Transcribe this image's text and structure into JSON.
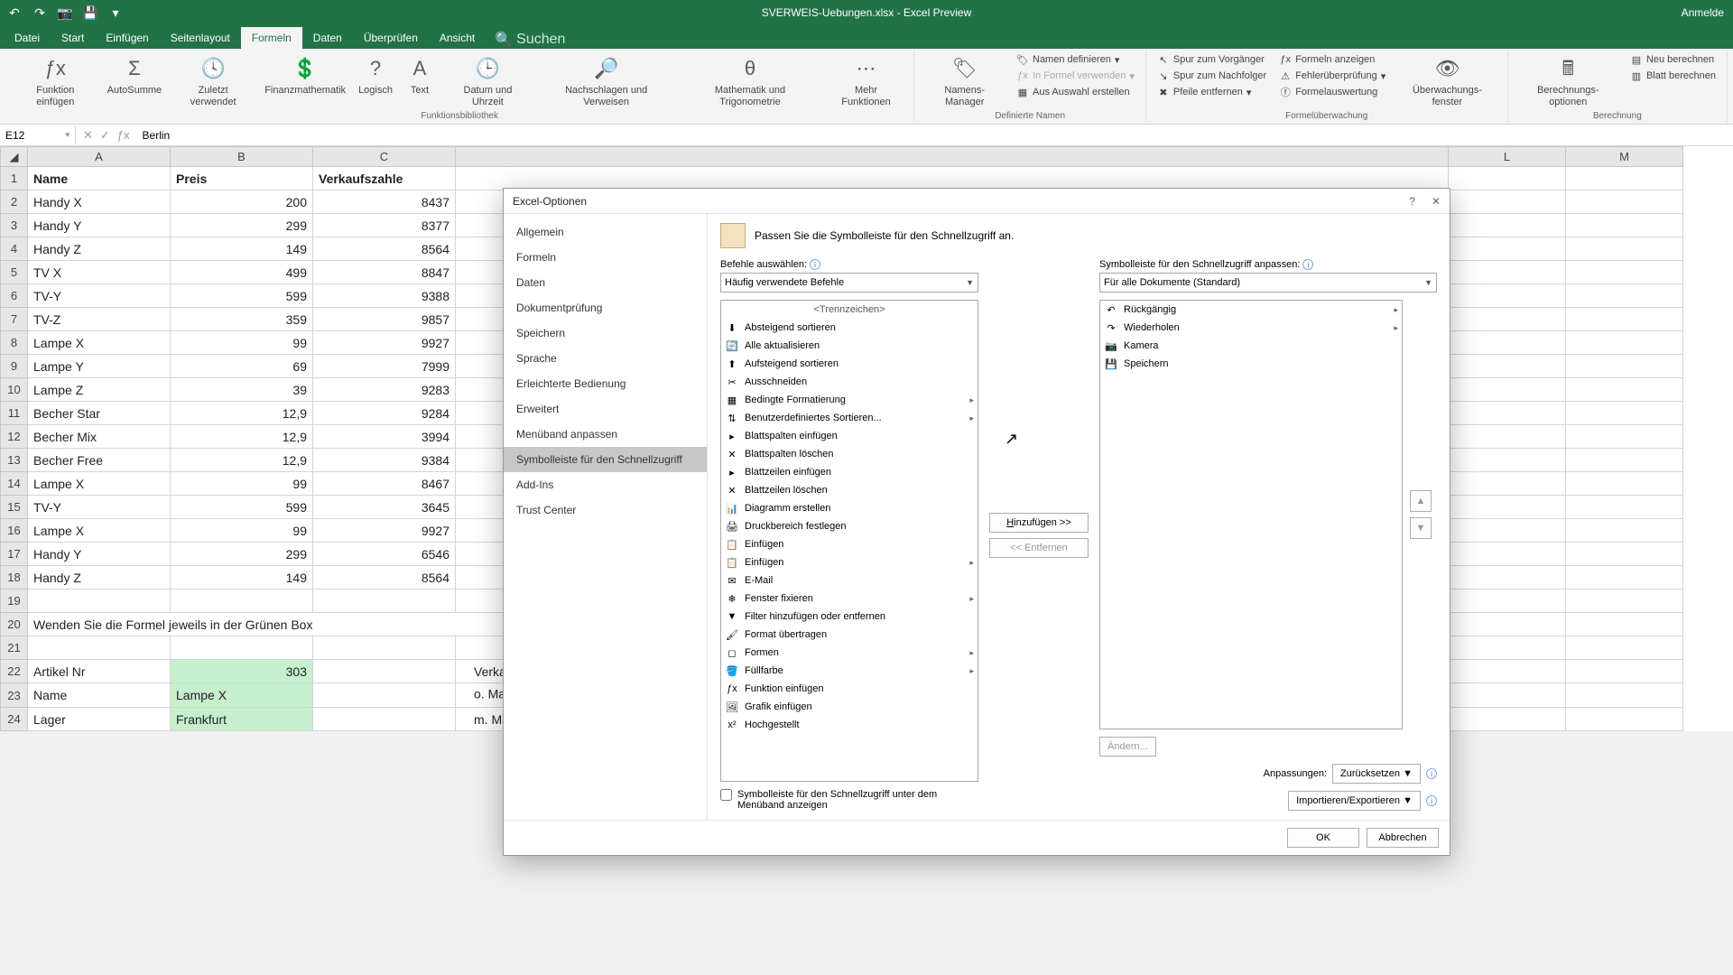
{
  "titlebar": {
    "title": "SVERWEIS-Uebungen.xlsx - Excel Preview",
    "signin": "Anmelde"
  },
  "tabs": {
    "datei": "Datei",
    "start": "Start",
    "einfuegen": "Einfügen",
    "seitenlayout": "Seitenlayout",
    "formeln": "Formeln",
    "daten": "Daten",
    "ueberpruefen": "Überprüfen",
    "ansicht": "Ansicht",
    "suchen": "Suchen"
  },
  "ribbon": {
    "fx": "Funktion einfügen",
    "autosumme": "AutoSumme",
    "zuletzt": "Zuletzt verwendet",
    "finanz": "Finanzmathematik",
    "logisch": "Logisch",
    "text": "Text",
    "datum": "Datum und Uhrzeit",
    "nachschlagen": "Nachschlagen und Verweisen",
    "math": "Mathematik und Trigonometrie",
    "mehr": "Mehr Funktionen",
    "grp_bib": "Funktionsbibliothek",
    "namens": "Namens-Manager",
    "namen_def": "Namen definieren",
    "in_formel": "In Formel verwenden",
    "aus_auswahl": "Aus Auswahl erstellen",
    "grp_namen": "Definierte Namen",
    "spur_vor": "Spur zum Vorgänger",
    "spur_nach": "Spur zum Nachfolger",
    "pfeile": "Pfeile entfernen",
    "formeln_anz": "Formeln anzeigen",
    "fehler": "Fehlerüberprüfung",
    "auswertung": "Formelauswertung",
    "ueberwachung": "Überwachungs-fenster",
    "grp_ueberw": "Formelüberwachung",
    "berech_opt": "Berechnungs-optionen",
    "neu_ber": "Neu berechnen",
    "blatt_ber": "Blatt berechnen",
    "grp_ber": "Berechnung"
  },
  "formula_bar": {
    "name_box": "E12",
    "value": "Berlin"
  },
  "cols": [
    "A",
    "B",
    "C",
    "L",
    "M"
  ],
  "sheet": {
    "header": {
      "name": "Name",
      "preis": "Preis",
      "verkauf": "Verkaufszahle"
    },
    "rows": [
      {
        "n": "Handy X",
        "p": "200",
        "v": "8437"
      },
      {
        "n": "Handy Y",
        "p": "299",
        "v": "8377"
      },
      {
        "n": "Handy Z",
        "p": "149",
        "v": "8564"
      },
      {
        "n": "TV X",
        "p": "499",
        "v": "8847"
      },
      {
        "n": "TV-Y",
        "p": "599",
        "v": "9388"
      },
      {
        "n": "TV-Z",
        "p": "359",
        "v": "9857"
      },
      {
        "n": "Lampe X",
        "p": "99",
        "v": "9927"
      },
      {
        "n": "Lampe Y",
        "p": "69",
        "v": "7999"
      },
      {
        "n": "Lampe Z",
        "p": "39",
        "v": "9283"
      },
      {
        "n": "Becher Star",
        "p": "12,9",
        "v": "9284"
      },
      {
        "n": "Becher Mix",
        "p": "12,9",
        "v": "3994"
      },
      {
        "n": "Becher Free",
        "p": "12,9",
        "v": "9384"
      },
      {
        "n": "Lampe X",
        "p": "99",
        "v": "8467"
      },
      {
        "n": "TV-Y",
        "p": "599",
        "v": "3645"
      },
      {
        "n": "Lampe X",
        "p": "99",
        "v": "9927"
      },
      {
        "n": "Handy Y",
        "p": "299",
        "v": "6546"
      },
      {
        "n": "Handy Z",
        "p": "149",
        "v": "8564"
      }
    ],
    "row20": "Wenden Sie die Formel jeweils in der Grünen Box",
    "r22a": "Artikel Nr",
    "r22b": "303",
    "r22d": "Verkaufszahlen",
    "r23a": "Name",
    "r23b": "Lampe X",
    "r23d": "o. Matrix",
    "r24a": "Lager",
    "r24b": "Frankfurt",
    "r24d": "m. Matrix"
  },
  "dialog": {
    "title": "Excel-Optionen",
    "nav": [
      "Allgemein",
      "Formeln",
      "Daten",
      "Dokumentprüfung",
      "Speichern",
      "Sprache",
      "Erleichterte Bedienung",
      "Erweitert",
      "Menüband anpassen",
      "Symbolleiste für den Schnellzugriff",
      "Add-Ins",
      "Trust Center"
    ],
    "nav_active_index": 9,
    "headline": "Passen Sie die Symbolleiste für den Schnellzugriff an.",
    "left_label": "Befehle auswählen:",
    "left_combo": "Häufig verwendete Befehle",
    "right_label": "Symbolleiste für den Schnellzugriff anpassen:",
    "right_combo": "Für alle Dokumente (Standard)",
    "separator": "<Trennzeichen>",
    "left_items": [
      {
        "t": "Absteigend sortieren"
      },
      {
        "t": "Alle aktualisieren"
      },
      {
        "t": "Aufsteigend sortieren"
      },
      {
        "t": "Ausschneiden"
      },
      {
        "t": "Bedingte Formatierung",
        "sub": true
      },
      {
        "t": "Benutzerdefiniertes Sortieren...",
        "sub": true
      },
      {
        "t": "Blattspalten einfügen"
      },
      {
        "t": "Blattspalten löschen"
      },
      {
        "t": "Blattzeilen einfügen"
      },
      {
        "t": "Blattzeilen löschen"
      },
      {
        "t": "Diagramm erstellen"
      },
      {
        "t": "Druckbereich festlegen"
      },
      {
        "t": "Einfügen"
      },
      {
        "t": "Einfügen",
        "sub": true
      },
      {
        "t": "E-Mail"
      },
      {
        "t": "Fenster fixieren",
        "sub": true
      },
      {
        "t": "Filter hinzufügen oder entfernen"
      },
      {
        "t": "Format übertragen"
      },
      {
        "t": "Formen",
        "sub": true
      },
      {
        "t": "Füllfarbe",
        "sub": true
      },
      {
        "t": "Funktion einfügen"
      },
      {
        "t": "Grafik einfügen"
      },
      {
        "t": "Hochgestellt"
      }
    ],
    "right_items": [
      {
        "t": "Rückgängig",
        "sub": true
      },
      {
        "t": "Wiederholen",
        "sub": true
      },
      {
        "t": "Kamera"
      },
      {
        "t": "Speichern"
      }
    ],
    "btn_add": "Hinzufügen >>",
    "btn_remove": "<< Entfernen",
    "btn_modify": "Ändern...",
    "chk_below": "Symbolleiste für den Schnellzugriff unter dem Menüband anzeigen",
    "anpassungen": "Anpassungen:",
    "reset": "Zurücksetzen",
    "import": "Importieren/Exportieren",
    "ok": "OK",
    "cancel": "Abbrechen"
  }
}
